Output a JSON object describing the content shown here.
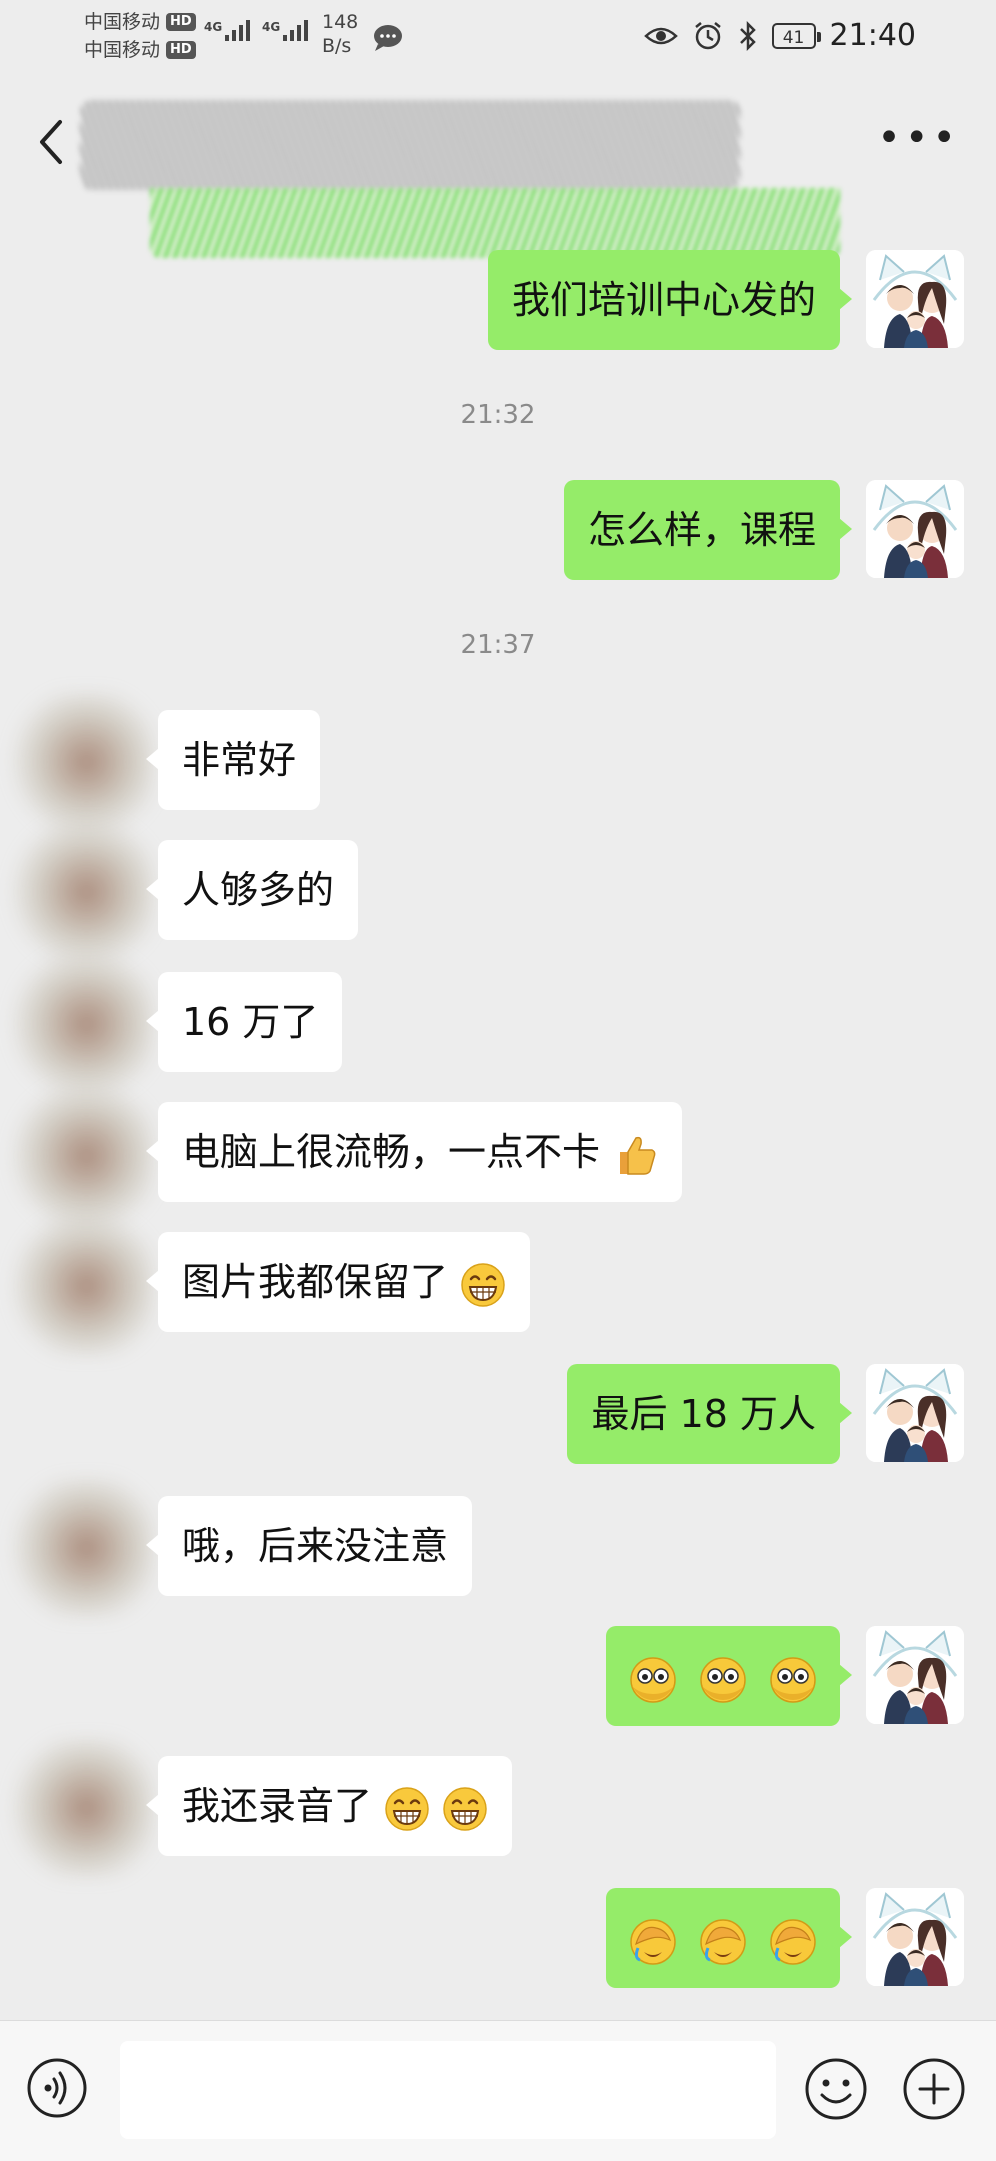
{
  "status_bar": {
    "carrier_1": "中国移动",
    "carrier_2": "中国移动",
    "hd": "HD",
    "net_type": "4G",
    "speed_value": "148",
    "speed_unit": "B/s",
    "battery": "41",
    "time": "21:40"
  },
  "timestamps": [
    "21:32",
    "21:37"
  ],
  "messages": [
    {
      "dir": "out",
      "text": "我们培训中心发的"
    },
    {
      "dir": "out",
      "text": "怎么样，课程"
    },
    {
      "dir": "in",
      "text": "非常好"
    },
    {
      "dir": "in",
      "text": "人够多的"
    },
    {
      "dir": "in",
      "text": "16 万了"
    },
    {
      "dir": "in",
      "text": "电脑上很流畅，一点不卡",
      "emoji": "thumbs-up"
    },
    {
      "dir": "in",
      "text": "图片我都保留了",
      "emoji": "grin"
    },
    {
      "dir": "out",
      "text": "最后 18 万人"
    },
    {
      "dir": "in",
      "text": "哦，后来没注意"
    },
    {
      "dir": "out",
      "text": "",
      "emoji": "peek x3"
    },
    {
      "dir": "in",
      "text": "我还录音了",
      "emoji": "grin x2"
    },
    {
      "dir": "out",
      "text": "",
      "emoji": "facepalm x3"
    }
  ],
  "colors": {
    "background": "#ededed",
    "outgoing_bubble": "#95ec69",
    "incoming_bubble": "#ffffff",
    "timestamp": "#8a8a8a"
  },
  "icons": [
    "back-icon",
    "more-icon",
    "voice-icon",
    "emoji-icon",
    "plus-icon"
  ]
}
